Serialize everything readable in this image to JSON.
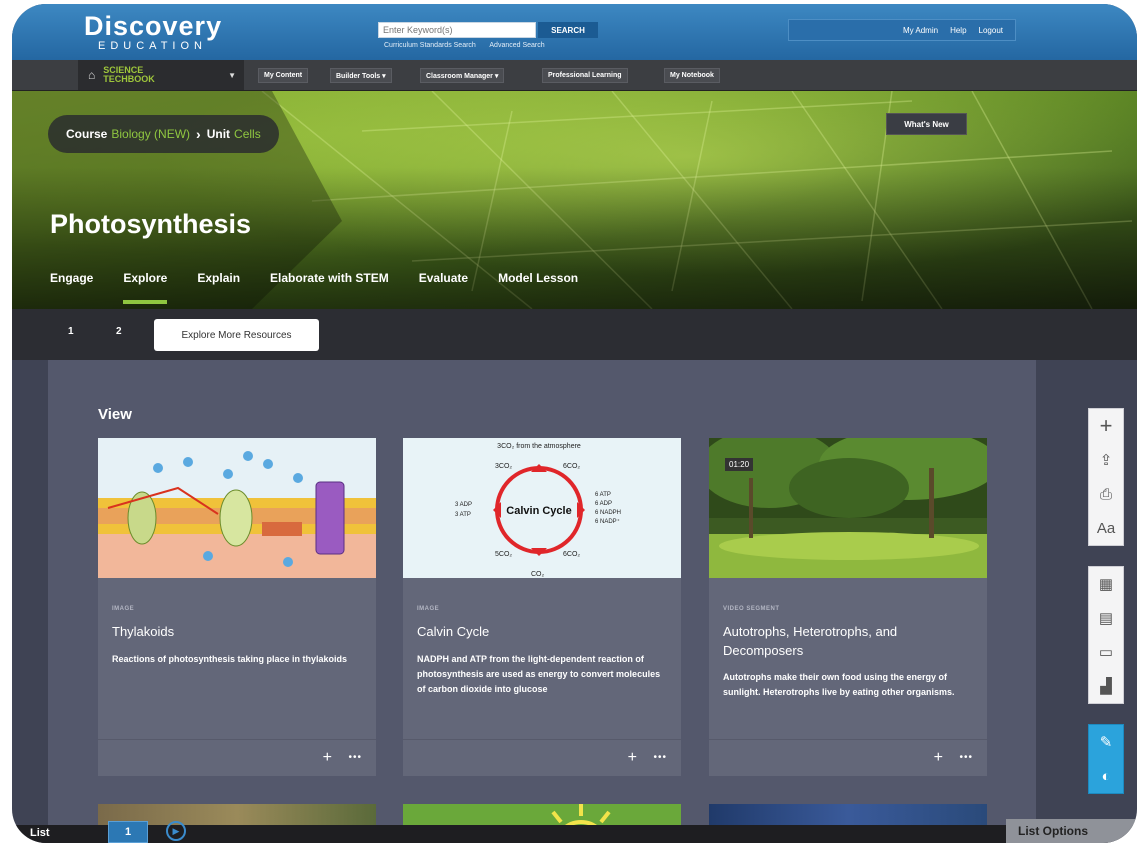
{
  "header": {
    "logo_main": "Discovery",
    "logo_sub": "EDUCATION",
    "search_placeholder": "Enter Keyword(s)",
    "search_button": "SEARCH",
    "search_links": [
      "Curriculum Standards Search",
      "Advanced Search"
    ],
    "util_links": [
      "My Admin",
      "Help",
      "Logout"
    ]
  },
  "nav": {
    "product_line1": "SCIENCE",
    "product_line2": "TECHBOOK",
    "items": [
      "My Content",
      "Builder Tools ▾",
      "Classroom Manager ▾",
      "Professional Learning",
      "My Notebook"
    ]
  },
  "hero": {
    "course_label": "Course",
    "course_value": "Biology (NEW)",
    "unit_label": "Unit",
    "unit_value": "Cells",
    "whats_new": "What's New",
    "title": "Photosynthesis",
    "tabs": [
      "Engage",
      "Explore",
      "Explain",
      "Elaborate with STEM",
      "Evaluate",
      "Model Lesson"
    ],
    "active_tab": "Explore"
  },
  "subtabs": {
    "pages": [
      "1",
      "2"
    ],
    "more_button": "Explore More Resources"
  },
  "content": {
    "section_title": "View",
    "cards": [
      {
        "type": "IMAGE",
        "title": "Thylakoids",
        "description": "Reactions of photosynthesis taking place in thylakoids"
      },
      {
        "type": "IMAGE",
        "title": "Calvin Cycle",
        "description": "NADPH and ATP from the light-dependent reaction of photosynthesis are used as energy to convert molecules of carbon dioxide into glucose"
      },
      {
        "type": "VIDEO SEGMENT",
        "title": "Autotrophs, Heterotrophs, and Decomposers",
        "description": "Autotrophs make their own food using the energy of sunlight. Heterotrophs live by eating other organisms.",
        "duration": "01:20"
      }
    ],
    "calvin_labels": {
      "top": "3CO₂ from the atmosphere",
      "center": "Calvin Cycle",
      "n1": "3CO₂",
      "n2": "6CO₂",
      "n3": "5CO₂",
      "n4": "6CO₂",
      "left1": "3 ADP",
      "left2": "3 ATP",
      "right1": "6 ATP",
      "right2": "6 ADP",
      "right3": "6 NADPH",
      "right4": "6 NADP⁺",
      "bottom": "CO₂"
    }
  },
  "tools": {
    "group1": [
      "plus-icon",
      "upload-icon",
      "print-icon",
      "text-size-icon"
    ],
    "group2": [
      "calendar-icon",
      "book-icon",
      "presentation-icon",
      "chart-icon"
    ],
    "group3": [
      "eraser-icon",
      "toggle-icon"
    ],
    "text_size_label": "Aa"
  },
  "bottom": {
    "list_label": "List",
    "list_count": "1",
    "options_label": "List Options"
  },
  "colors": {
    "accent_green": "#8fc640",
    "header_blue": "#2467a2",
    "tool_blue": "#2ba3dc"
  }
}
